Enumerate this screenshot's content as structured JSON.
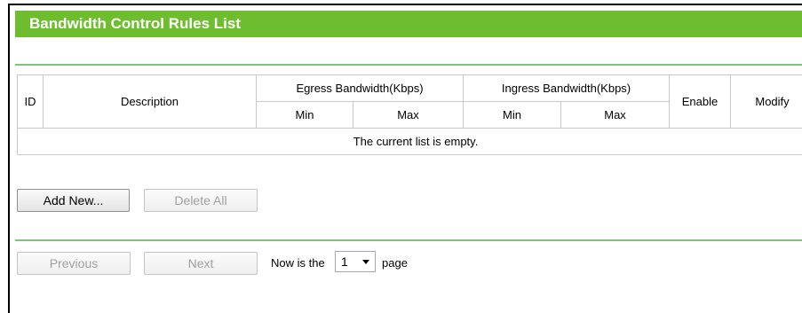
{
  "panel": {
    "title": "Bandwidth Control Rules List"
  },
  "table": {
    "headers": {
      "id": "ID",
      "description": "Description",
      "egress": "Egress Bandwidth(Kbps)",
      "ingress": "Ingress Bandwidth(Kbps)",
      "enable": "Enable",
      "modify": "Modify",
      "egress_min": "Min",
      "egress_max": "Max",
      "ingress_min": "Min",
      "ingress_max": "Max"
    },
    "empty_message": "The current list is empty."
  },
  "actions": {
    "add_new": "Add New...",
    "delete_all": "Delete All"
  },
  "pager": {
    "previous": "Previous",
    "next": "Next",
    "prefix": "Now is the",
    "page_value": "1",
    "suffix": "page"
  },
  "colors": {
    "accent": "#6dbd2f",
    "divider": "#7ec47e"
  }
}
